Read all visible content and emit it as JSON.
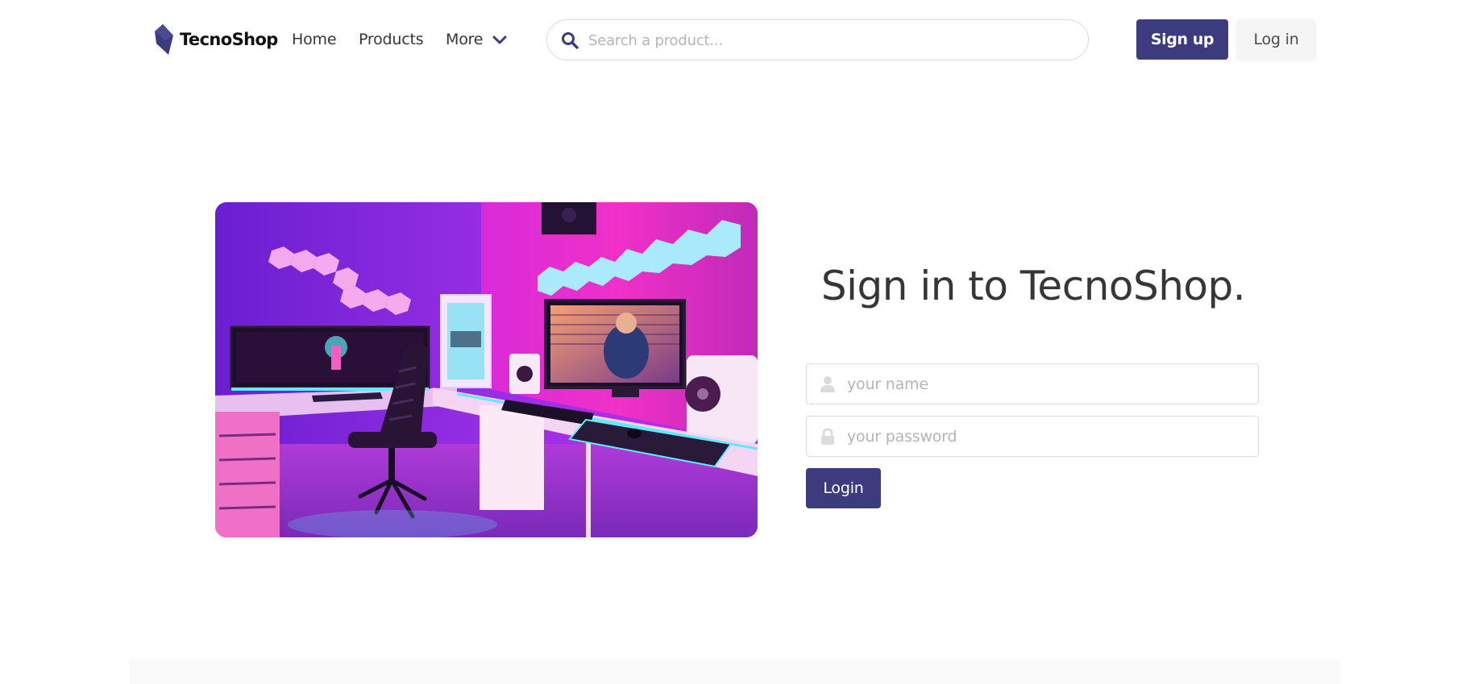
{
  "brand": {
    "name": "TecnoShop",
    "color": "#3b3b7d"
  },
  "nav": {
    "home": "Home",
    "products": "Products",
    "more": "More"
  },
  "search": {
    "placeholder": "Search a product...",
    "value": ""
  },
  "header_actions": {
    "signup": "Sign up",
    "login": "Log in"
  },
  "login": {
    "title": "Sign in to TecnoShop.",
    "name_placeholder": "your name",
    "password_placeholder": "your password",
    "submit": "Login"
  },
  "icons": {
    "search": "search-icon",
    "user": "user-icon",
    "lock": "lock-icon",
    "chevron": "chevron-down-icon",
    "logo": "tecnoshop-logo-icon"
  },
  "colors": {
    "primary": "#3b3b7d",
    "border": "#dbdbdb",
    "placeholder": "#b5b5b5",
    "text": "#363636"
  }
}
